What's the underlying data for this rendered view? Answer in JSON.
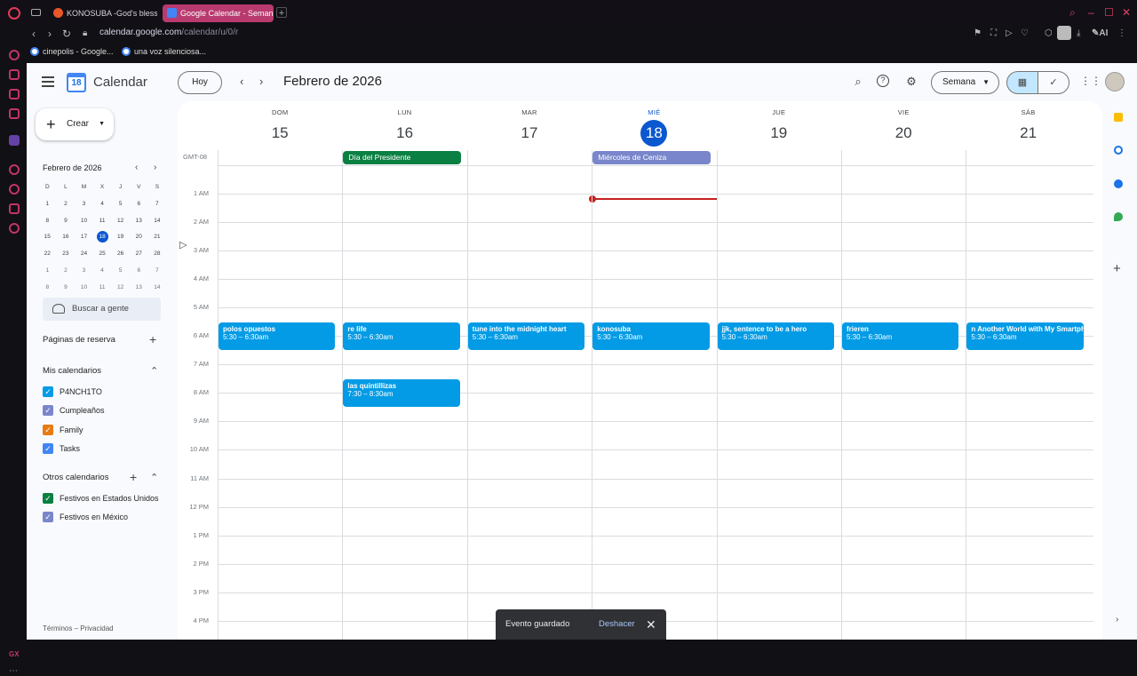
{
  "browser": {
    "tabs": [
      {
        "label": "KONOSUBA -God's blessin"
      },
      {
        "label": "Google Calendar - Seman"
      }
    ],
    "url_domain": "calendar.google.com",
    "url_path": "/calendar/u/0/r",
    "bookmarks": [
      {
        "label": "cinepolis - Google..."
      },
      {
        "label": "una voz silenciosa..."
      }
    ],
    "ai_label": "AI",
    "gx_label": "GX"
  },
  "header": {
    "app_title": "Calendar",
    "logo_day": "18",
    "today_label": "Hoy",
    "month_title": "Febrero de 2026",
    "view_label": "Semana"
  },
  "left": {
    "create_label": "Crear",
    "mini_title": "Febrero de 2026",
    "weekday_heads": [
      "D",
      "L",
      "M",
      "X",
      "J",
      "V",
      "S"
    ],
    "mini_weeks": [
      [
        "1",
        "2",
        "3",
        "4",
        "5",
        "6",
        "7"
      ],
      [
        "8",
        "9",
        "10",
        "11",
        "12",
        "13",
        "14"
      ],
      [
        "15",
        "16",
        "17",
        "18",
        "19",
        "20",
        "21"
      ],
      [
        "22",
        "23",
        "24",
        "25",
        "26",
        "27",
        "28"
      ],
      [
        "1",
        "2",
        "3",
        "4",
        "5",
        "6",
        "7"
      ],
      [
        "8",
        "9",
        "10",
        "11",
        "12",
        "13",
        "14"
      ]
    ],
    "search_people": "Buscar a gente",
    "booking_pages": "Páginas de reserva",
    "my_calendars_title": "Mis calendarios",
    "my_calendars": [
      {
        "label": "P4NCH1TO",
        "color": "#039be5"
      },
      {
        "label": "Cumpleaños",
        "color": "#7986cb"
      },
      {
        "label": "Family",
        "color": "#e67c13"
      },
      {
        "label": "Tasks",
        "color": "#4285f4"
      }
    ],
    "other_calendars_title": "Otros calendarios",
    "other_calendars": [
      {
        "label": "Festivos en Estados Unidos",
        "color": "#0b8043"
      },
      {
        "label": "Festivos en México",
        "color": "#7986cb"
      }
    ],
    "footer": "Términos – Privacidad"
  },
  "week": {
    "timezone": "GMT-08",
    "days": [
      {
        "name": "DOM",
        "date": "15"
      },
      {
        "name": "LUN",
        "date": "16"
      },
      {
        "name": "MAR",
        "date": "17"
      },
      {
        "name": "MIÉ",
        "date": "18",
        "today": true
      },
      {
        "name": "JUE",
        "date": "19"
      },
      {
        "name": "VIE",
        "date": "20"
      },
      {
        "name": "SÁB",
        "date": "21"
      }
    ],
    "all_day": [
      {
        "title": "Día del Presidente",
        "day": 1,
        "color": "#0b8043"
      },
      {
        "title": "Miércoles de Ceniza",
        "day": 3,
        "color": "#7986cb"
      }
    ],
    "hours": [
      "1 AM",
      "2 AM",
      "3 AM",
      "4 AM",
      "5 AM",
      "6 AM",
      "7 AM",
      "8 AM",
      "9 AM",
      "10 AM",
      "11 AM",
      "12 PM",
      "1 PM",
      "2 PM",
      "3 PM",
      "4 PM"
    ],
    "events": [
      {
        "title": "polos opuestos",
        "time": "5:30 – 6:30am",
        "day": 0,
        "start": 5.5
      },
      {
        "title": "re life",
        "time": "5:30 – 6:30am",
        "day": 1,
        "start": 5.5
      },
      {
        "title": "las quintillizas",
        "time": "7:30 – 8:30am",
        "day": 1,
        "start": 7.5
      },
      {
        "title": "tune into the midnight heart",
        "time": "5:30 – 6:30am",
        "day": 2,
        "start": 5.5
      },
      {
        "title": "konosuba",
        "time": "5:30 – 6:30am",
        "day": 3,
        "start": 5.5
      },
      {
        "title": "jjk, sentence to be a hero",
        "time": "5:30 – 6:30am",
        "day": 4,
        "start": 5.5
      },
      {
        "title": "frieren",
        "time": "5:30 – 6:30am",
        "day": 5,
        "start": 5.5
      },
      {
        "title": "n Another World with My Smartphone",
        "time": "5:30 – 6:30am",
        "day": 6,
        "start": 5.5
      }
    ],
    "event_color": "#039be5",
    "now_line_color": "#c5221f"
  },
  "toast": {
    "message": "Evento guardado",
    "undo_label": "Deshacer"
  }
}
